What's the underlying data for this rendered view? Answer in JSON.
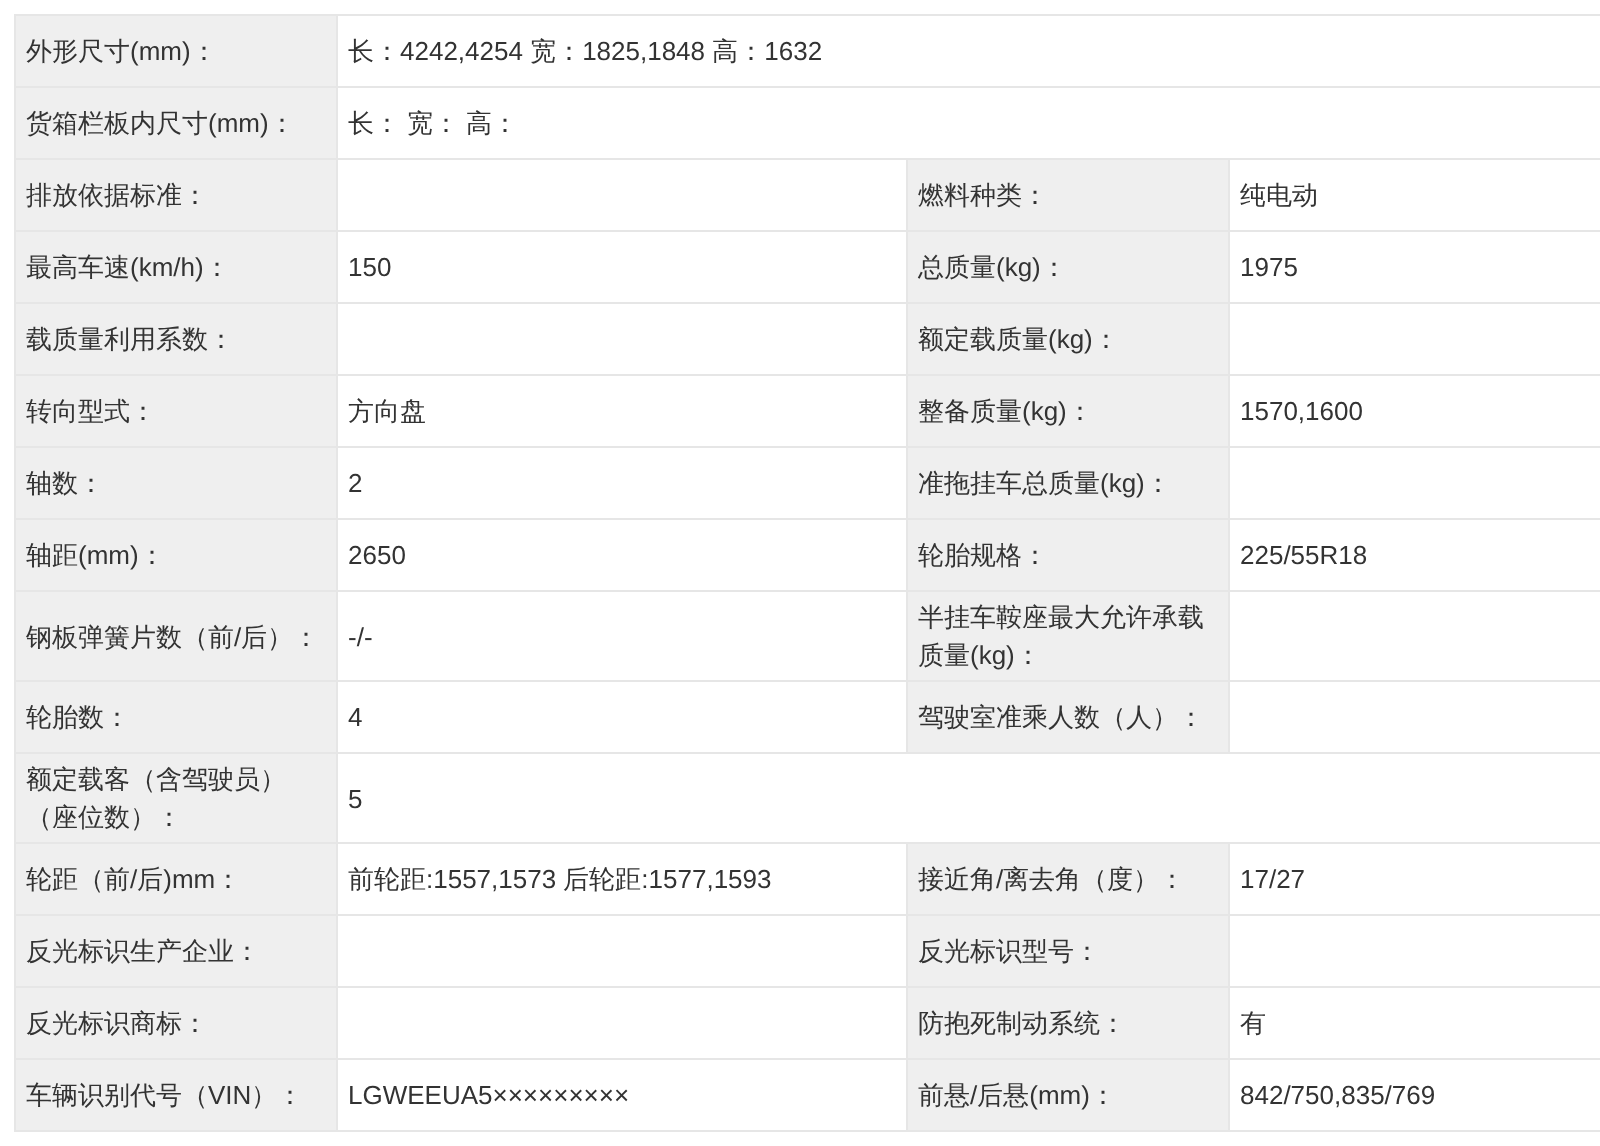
{
  "rows": [
    {
      "kind": "wide",
      "label": "外形尺寸(mm)：",
      "value": "长：4242,4254 宽：1825,1848 高：1632"
    },
    {
      "kind": "wide",
      "label": "货箱栏板内尺寸(mm)：",
      "value": "长： 宽： 高："
    },
    {
      "kind": "pair",
      "cells": [
        {
          "label": "排放依据标准："
        },
        {
          "label": "燃料种类：",
          "value": "纯电动"
        }
      ]
    },
    {
      "kind": "pair",
      "cells": [
        {
          "label": "最高车速(km/h)：",
          "value": "150"
        },
        {
          "label": "总质量(kg)：",
          "value": "1975"
        }
      ]
    },
    {
      "kind": "pair",
      "cells": [
        {
          "label": "载质量利用系数："
        },
        {
          "label": "额定载质量(kg)："
        }
      ]
    },
    {
      "kind": "pair",
      "cells": [
        {
          "label": "转向型式：",
          "value": "方向盘"
        },
        {
          "label": "整备质量(kg)：",
          "value": "1570,1600"
        }
      ]
    },
    {
      "kind": "pair",
      "cells": [
        {
          "label": "轴数：",
          "value": "2"
        },
        {
          "label": "准拖挂车总质量(kg)："
        }
      ]
    },
    {
      "kind": "pair",
      "cells": [
        {
          "label": "轴距(mm)：",
          "value": "2650"
        },
        {
          "label": "轮胎规格：",
          "value": "225/55R18"
        }
      ]
    },
    {
      "kind": "pair",
      "cells": [
        {
          "label": "钢板弹簧片数（前/后）：",
          "value": "-/-"
        },
        {
          "label": "半挂车鞍座最大允许承载质量(kg)："
        }
      ]
    },
    {
      "kind": "pair",
      "cells": [
        {
          "label": "轮胎数：",
          "value": "4"
        },
        {
          "label": "驾驶室准乘人数（人）："
        }
      ]
    },
    {
      "kind": "wide",
      "label": "额定载客（含驾驶员）（座位数）：",
      "value": "5"
    },
    {
      "kind": "pair",
      "cells": [
        {
          "label": "轮距（前/后)mm：",
          "value": "前轮距:1557,1573 后轮距:1577,1593"
        },
        {
          "label": "接近角/离去角（度）：",
          "value": "17/27"
        }
      ]
    },
    {
      "kind": "pair",
      "cells": [
        {
          "label": "反光标识生产企业："
        },
        {
          "label": "反光标识型号："
        }
      ]
    },
    {
      "kind": "pair",
      "cells": [
        {
          "label": "反光标识商标："
        },
        {
          "label": "防抱死制动系统：",
          "value": "有"
        }
      ]
    },
    {
      "kind": "pair",
      "cells": [
        {
          "label": "车辆识别代号（VIN）：",
          "value": "LGWEEUA5×××××××××"
        },
        {
          "label": "前悬/后悬(mm)：",
          "value": "842/750,835/769"
        }
      ]
    }
  ]
}
